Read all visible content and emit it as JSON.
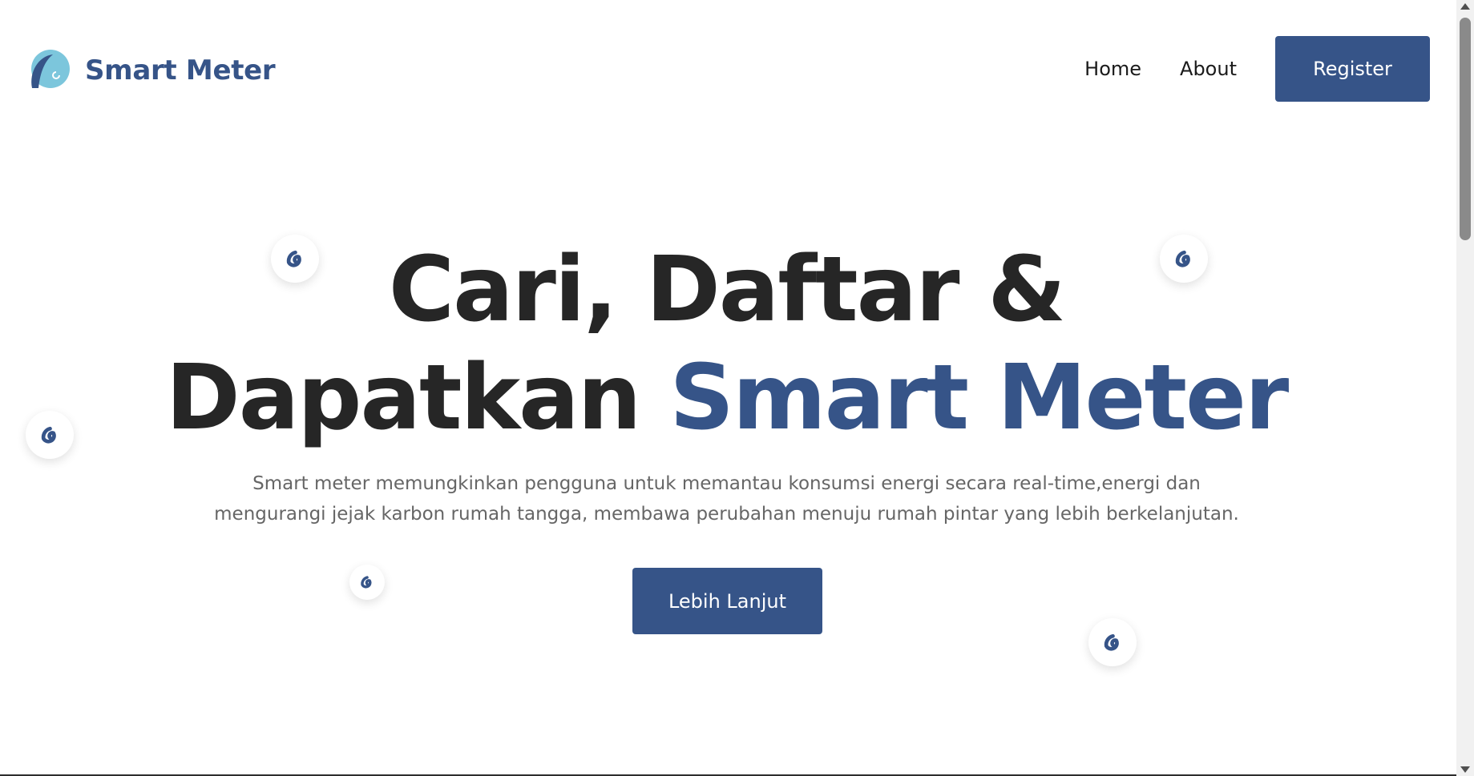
{
  "brand": {
    "name": "Smart Meter",
    "logo_icon": "swirl-logo-icon",
    "colors": {
      "primary": "#365488",
      "light": "#7cc6dc"
    }
  },
  "nav": {
    "home": "Home",
    "about": "About",
    "register": "Register"
  },
  "hero": {
    "title_line1": "Cari, Daftar &",
    "title_line2_prefix": "Dapatkan ",
    "title_line2_accent": "Smart Meter",
    "subtitle_line1": "Smart meter memungkinkan pengguna untuk memantau konsumsi energi secara real-time,energi dan",
    "subtitle_line2": "mengurangi jejak karbon rumah tangga, membawa perubahan menuju rumah pintar yang lebih berkelanjutan.",
    "cta": "Lebih Lanjut"
  },
  "colors": {
    "accent": "#365488",
    "heading": "#262626",
    "body_text": "#666666"
  }
}
